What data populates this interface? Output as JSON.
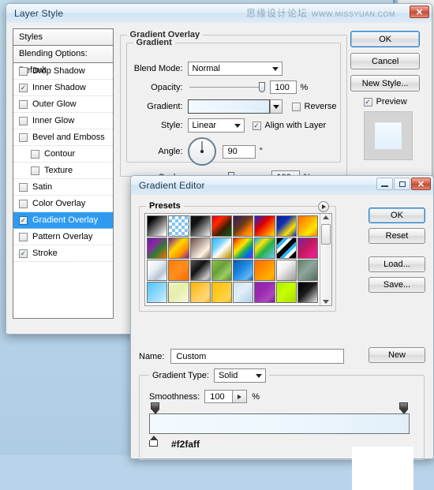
{
  "watermark": {
    "cn": "思缘设计论坛",
    "en": "WWW.MISSYUAN.COM"
  },
  "layer_style": {
    "title": "Layer Style",
    "close_label": "✕",
    "styles_header": "Styles",
    "blending_options": "Blending Options: Default",
    "effects": [
      {
        "label": "Drop Shadow",
        "checked": false,
        "sub": false,
        "selected": false
      },
      {
        "label": "Inner Shadow",
        "checked": true,
        "sub": false,
        "selected": false
      },
      {
        "label": "Outer Glow",
        "checked": false,
        "sub": false,
        "selected": false
      },
      {
        "label": "Inner Glow",
        "checked": false,
        "sub": false,
        "selected": false
      },
      {
        "label": "Bevel and Emboss",
        "checked": false,
        "sub": false,
        "selected": false
      },
      {
        "label": "Contour",
        "checked": false,
        "sub": true,
        "selected": false
      },
      {
        "label": "Texture",
        "checked": false,
        "sub": true,
        "selected": false
      },
      {
        "label": "Satin",
        "checked": false,
        "sub": false,
        "selected": false
      },
      {
        "label": "Color Overlay",
        "checked": false,
        "sub": false,
        "selected": false
      },
      {
        "label": "Gradient Overlay",
        "checked": true,
        "sub": false,
        "selected": true
      },
      {
        "label": "Pattern Overlay",
        "checked": false,
        "sub": false,
        "selected": false
      },
      {
        "label": "Stroke",
        "checked": true,
        "sub": false,
        "selected": false
      }
    ],
    "panel": {
      "group_title": "Gradient Overlay",
      "subgroup_title": "Gradient",
      "blend_mode_label": "Blend Mode:",
      "blend_mode_value": "Normal",
      "opacity_label": "Opacity:",
      "opacity_value": "100",
      "opacity_unit": "%",
      "gradient_label": "Gradient:",
      "reverse_label": "Reverse",
      "reverse_checked": false,
      "style_label": "Style:",
      "style_value": "Linear",
      "align_label": "Align with Layer",
      "align_checked": true,
      "angle_label": "Angle:",
      "angle_value": "90",
      "angle_unit": "°",
      "scale_label": "Scale:",
      "scale_value": "100",
      "scale_unit": "%"
    },
    "buttons": {
      "ok": "OK",
      "cancel": "Cancel",
      "new_style": "New Style...",
      "preview_label": "Preview",
      "preview_checked": true
    }
  },
  "gradient_editor": {
    "title": "Gradient Editor",
    "minimize_label": "—",
    "maximize_label": "□",
    "close_label": "✕",
    "presets_label": "Presets",
    "buttons": {
      "ok": "OK",
      "reset": "Reset",
      "load": "Load...",
      "save": "Save...",
      "new": "New"
    },
    "name_label": "Name:",
    "name_value": "Custom",
    "gradient_type_label": "Gradient Type:",
    "gradient_type_value": "Solid",
    "smoothness_label": "Smoothness:",
    "smoothness_value": "100",
    "smoothness_unit": "%",
    "stop_color_hex": "#f2faff",
    "gradient_preview_colors": [
      "#f2faff",
      "#eef7fd",
      "#e2eff9"
    ],
    "presets": [
      "linear-gradient(135deg,#000 0%,#000 18%,#ffffff 95%)",
      "repeating-conic-gradient(#7ec4ef 0% 25%,#ffffff 0% 50%) 0 0/8px 8px",
      "linear-gradient(135deg,#111 0%,#111 30%,#f5f5f5 100%)",
      "linear-gradient(135deg,#e1001a 0%,#ff2a00 30%,#3d1d00 62%,#0b5e1f 100%)",
      "linear-gradient(135deg,#2a1a5e 0%,#6b3a1a 45%,#ff7a00 75%,#ffb000 100%)",
      "linear-gradient(135deg,#2222cc 0%,#e00000 40%,#ff6a00 70%,#ffe400 100%)",
      "linear-gradient(135deg,#0c1e8a 0%,#1030b8 35%,#ffe000 70%,#1030b8 100%)",
      "linear-gradient(135deg,#ff6a00 0%,#ffb400 45%,#ffe800 70%,#ff8000 100%)",
      "linear-gradient(135deg,#6a1b9a 0%,#8e24aa 30%,#2e7d32 60%,#ff6d00 100%)",
      "linear-gradient(135deg,#6a1b9a 0%,#ffd600 40%,#ff8f00 70%,#7b1fa2 100%)",
      "linear-gradient(135deg,#6d4c41 0%,#bcaaa4 40%,#fff3e0 70%,#8d6e63 100%)",
      "linear-gradient(135deg,#29b6f6 0%,#81d4fa 35%,#ffffff 55%,#c8a020 90%)",
      "linear-gradient(135deg,#e00000 0%,#ff8a00 20%,#ffe400 40%,#22b14c 60%,#0066ff 80%,#8a2be2 100%)",
      "linear-gradient(135deg,#00b0ff 0%,#ffe400 30%,#22b14c 55%,#7ec4ef 100%)",
      "repeating-linear-gradient(135deg,#000 0 6px,#29b6f6 6px 10px,#ffffff 10px 14px)",
      "linear-gradient(135deg,#7b1fa2 0%,#c2185b 45%,#e91e8c 80%,#d81b8a 100%)",
      "linear-gradient(135deg,#ffffff 0%,#e8eef5 40%,#b9c6d4 70%,#ffffff 100%)",
      "linear-gradient(135deg,#ff7a00 0%,#ff8f1f 50%,#ff6a00 100%)",
      "linear-gradient(135deg,#555 0%,#111 40%,#cccccc 85%,#888 100%)",
      "linear-gradient(135deg,#8bc34a 0%,#689f38 40%,#9ccc65 70%,#558b2f 100%)",
      "linear-gradient(135deg,#0b5aa8 0%,#1e88e5 45%,#64b5f6 80%,#1565c0 100%)",
      "linear-gradient(135deg,#ff6a00 0%,#ff9100 45%,#ffb300 80%,#fb8c00 100%)",
      "linear-gradient(135deg,#ffffff 0%,#f0f0f0 40%,#bdbdbd 75%,#9e9e9e 100%)",
      "linear-gradient(135deg,#607d6f 0%,#8fa79a 45%,#6b8279 80%,#4e6660 100%)",
      "linear-gradient(135deg,#4fc3f7 0%,#81d4fa 40%,#b3e5fc 80%,#e1f5fe 100%)",
      "linear-gradient(135deg,#f0f4c3 0%,#e6eea8 45%,#f7fadf 100%)",
      "linear-gradient(135deg,#ffb300 0%,#ffc94d 45%,#ffd97a 80%,#ffb300 100%)",
      "linear-gradient(135deg,#ffc107 0%,#ffca28 45%,#ffd54f 80%,#ffb300 100%)",
      "linear-gradient(135deg,#cfe3f2 0%,#e3eef8 45%,#b9d4ea 90%)",
      "linear-gradient(135deg,#8e24aa 0%,#9c27b0 40%,#ab47bc 75%,#7b1fa2 100%)",
      "linear-gradient(135deg,#aeea00 0%,#c6ff00 45%,#b2e400 85%)",
      "linear-gradient(135deg,#000000 0%,#1a1a1a 45%,#d6d6d6 95%)"
    ]
  }
}
